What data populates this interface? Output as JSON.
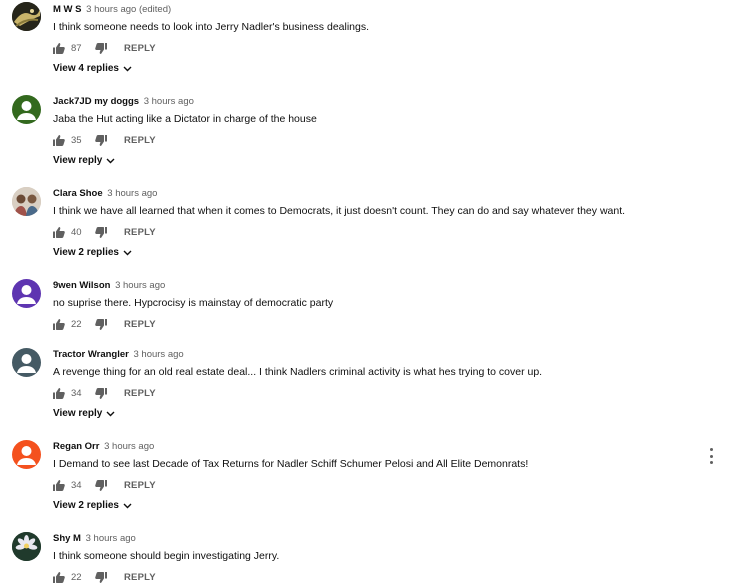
{
  "comments": [
    {
      "author": "M W S",
      "time": "3 hours ago (edited)",
      "text": "I think someone needs to look into Jerry Nadler's business dealings.",
      "likes": "87",
      "reply_label": "REPLY",
      "view_replies": "View 4 replies",
      "avatar_icon": "night-scene-avatar"
    },
    {
      "author": "Jack7JD my doggs",
      "time": "3 hours ago",
      "text": "Jaba the Hut acting like a Dictator in charge of the house",
      "likes": "35",
      "reply_label": "REPLY",
      "view_replies": "View reply",
      "avatar_icon": "green-default-avatar"
    },
    {
      "author": "Clara Shoe",
      "time": "3 hours ago",
      "text": "I think we have all learned that when it comes to Democrats, it just doesn't count. They can do and say whatever they want.",
      "likes": "40",
      "reply_label": "REPLY",
      "view_replies": "View 2 replies",
      "avatar_icon": "photo-avatar"
    },
    {
      "author": "9wen Wilson",
      "time": "3 hours ago",
      "text": "no suprise there. Hypcrocisy is mainstay of democratic party",
      "likes": "22",
      "reply_label": "REPLY",
      "avatar_icon": "purple-default-avatar"
    },
    {
      "author": "Tractor Wrangler",
      "time": "3 hours ago",
      "text": "A revenge thing for an old real estate deal... I think Nadlers criminal activity is what hes trying to cover up.",
      "likes": "34",
      "reply_label": "REPLY",
      "view_replies": "View reply",
      "avatar_icon": "gray-default-avatar"
    },
    {
      "author": "Regan Orr",
      "time": "3 hours ago",
      "text": "I Demand to see last Decade of Tax Returns for Nadler Schiff Schumer Pelosi and All Elite Demonrats!",
      "likes": "34",
      "reply_label": "REPLY",
      "view_replies": "View 2 replies",
      "avatar_icon": "orange-default-avatar"
    },
    {
      "author": "Shy M",
      "time": "3 hours ago",
      "text": "I think someone should begin investigating Jerry.",
      "likes": "22",
      "reply_label": "REPLY",
      "avatar_icon": "flower-photo-avatar"
    }
  ],
  "colors": {
    "secondary_text": "#606060",
    "primary_text": "#0f0f0f",
    "avatar_green": "#33691e",
    "avatar_purple": "#5e35b1",
    "avatar_gray": "#455a64",
    "avatar_orange": "#f4511e"
  }
}
